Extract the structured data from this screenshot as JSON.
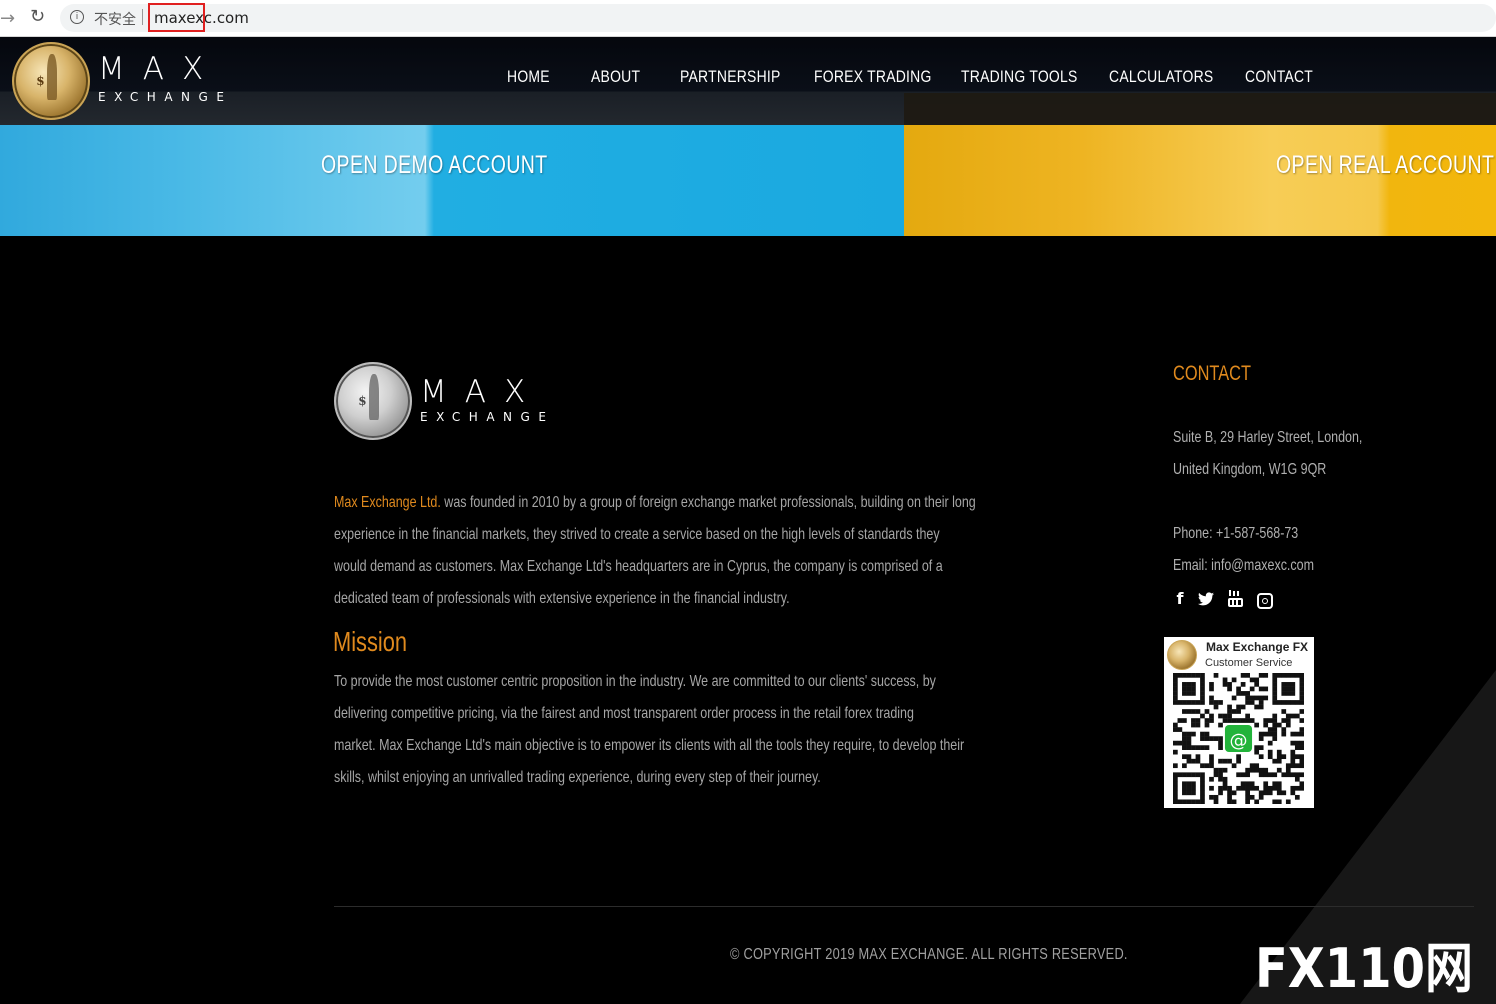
{
  "browser": {
    "security_label": "不安全",
    "url": "maxexc.com"
  },
  "brand": {
    "name": "MAX",
    "sub": "EXCHANGE"
  },
  "nav": {
    "items": [
      "HOME",
      "ABOUT",
      "PARTNERSHIP",
      "FOREX TRADING",
      "TRADING TOOLS",
      "CALCULATORS",
      "CONTACT"
    ]
  },
  "cta": {
    "demo": "OPEN DEMO ACCOUNT",
    "real": "OPEN REAL ACCOUNT"
  },
  "about": {
    "company_link": "Max Exchange Ltd.",
    "lines": [
      " was founded in 2010 by a group of foreign exchange market professionals, building on their long",
      "experience in the financial markets, they strived to create a service based on the high levels of standards they",
      "would demand as customers. Max Exchange Ltd's headquarters are in Cyprus, the company is comprised of a",
      "dedicated team of professionals with extensive experience in the financial industry."
    ]
  },
  "mission": {
    "heading": "Mission",
    "lines": [
      "To provide the most customer centric proposition in the industry. We are committed to our clients' success, by",
      "delivering competitive pricing, via the fairest and most transparent order process in the retail forex trading",
      "market. Max Exchange Ltd's main objective is to empower its clients with all the tools they require, to develop their",
      "skills, whilst enjoying an unrivalled trading experience, during every step of their journey."
    ]
  },
  "contact": {
    "heading": "CONTACT",
    "address_line1": "Suite B, 29 Harley Street, London,",
    "address_line2": "United Kingdom, W1G 9QR",
    "phone": "Phone: +1-587-568-73",
    "email": "Email: info@maxexc.com",
    "social_icons": [
      "facebook-icon",
      "twitter-icon",
      "youtube-icon",
      "instagram-icon"
    ]
  },
  "qr": {
    "title": "Max Exchange FX",
    "subtitle": "Customer Service"
  },
  "footer": {
    "copyright": "© COPYRIGHT 2019 MAX EXCHANGE. ALL RIGHTS RESERVED."
  },
  "watermark": {
    "text": "FX110网"
  },
  "colors": {
    "accent_orange": "#e08a1e",
    "demo_blue": "#1aa9e0",
    "real_gold": "#f3b70c"
  }
}
